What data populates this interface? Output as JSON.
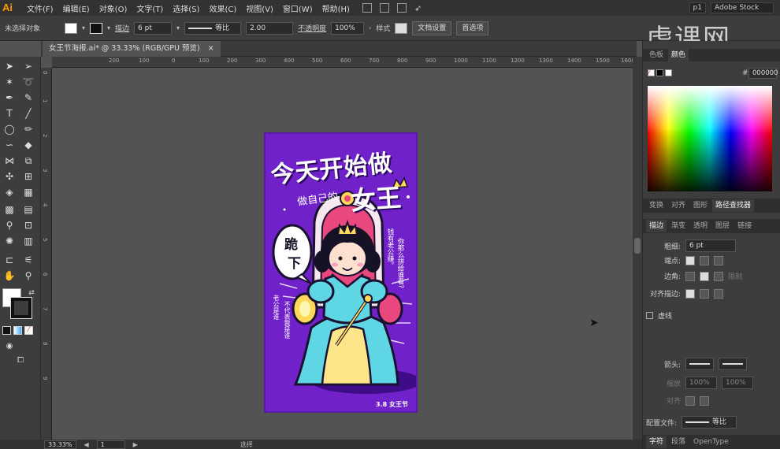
{
  "app": {
    "logo": "Ai"
  },
  "menu": [
    "文件(F)",
    "编辑(E)",
    "对象(O)",
    "文字(T)",
    "选择(S)",
    "效果(C)",
    "视图(V)",
    "窗口(W)",
    "帮助(H)"
  ],
  "menubar_right": {
    "workspace": "p1",
    "search_placeholder": "Adobe Stock"
  },
  "control_bar": {
    "selection_status": "未选择对象",
    "stroke_label": "描边",
    "stroke_weight": "6 pt",
    "stroke_profile": "等比",
    "brush_size": "2.00",
    "opacity_label": "不透明度",
    "opacity_value": "100%",
    "style_label": "样式",
    "doc_setup_button": "文档设置",
    "preferences_button": "首选项"
  },
  "watermark": "虎课网",
  "document_tab": {
    "title": "女王节海报.ai* @ 33.33% (RGB/GPU 预览)",
    "close": "×"
  },
  "ruler_top": [
    "200",
    "100",
    "0",
    "100",
    "200",
    "300",
    "400",
    "500",
    "600",
    "700",
    "800",
    "900",
    "1000",
    "1100",
    "1200",
    "1300",
    "1400",
    "1500",
    "1600"
  ],
  "ruler_left": [
    "0",
    "1",
    "2",
    "3",
    "4",
    "5",
    "6",
    "7",
    "8",
    "9"
  ],
  "poster": {
    "headline": "今天开始做",
    "subline": "做自己的",
    "queen": "女王",
    "bubble_1": "跪",
    "bubble_2": "下",
    "side_right_1": "你那么拼给谁看?",
    "side_right_2": "钱有老公赚。",
    "side_left_1": "老公是谁",
    "side_left_2": "不代表我是谁",
    "footer": "3.8 女王节"
  },
  "panel": {
    "color_tabs": [
      "色板",
      "颜色"
    ],
    "hex_label": "#",
    "hex_value": "000000",
    "mid_tabs": [
      "变换",
      "对齐",
      "图形",
      "路径查找器"
    ],
    "stroke_tabs": [
      "描边",
      "渐变",
      "透明",
      "图层",
      "链接"
    ],
    "weight_label": "粗细:",
    "weight_value": "6 pt",
    "cap_label": "端点:",
    "corner_label": "边角:",
    "limit_label": "限制",
    "align_label": "对齐描边:",
    "dashed_label": "虚线",
    "arrowhead_label": "箭头:",
    "scale_label": "缩放",
    "scale_value_1": "100%",
    "scale_value_2": "100%",
    "align2_label": "对齐",
    "profile_label": "配置文件:",
    "profile_value": "等比",
    "bottom_tabs": [
      "字符",
      "段落",
      "OpenType"
    ]
  },
  "statusbar": {
    "zoom": "33.33%",
    "page": "1",
    "tool": "选择"
  },
  "colors": {
    "poster_bg": "#7021c9",
    "accent": "#ff9a00",
    "stroke": "#000000"
  }
}
